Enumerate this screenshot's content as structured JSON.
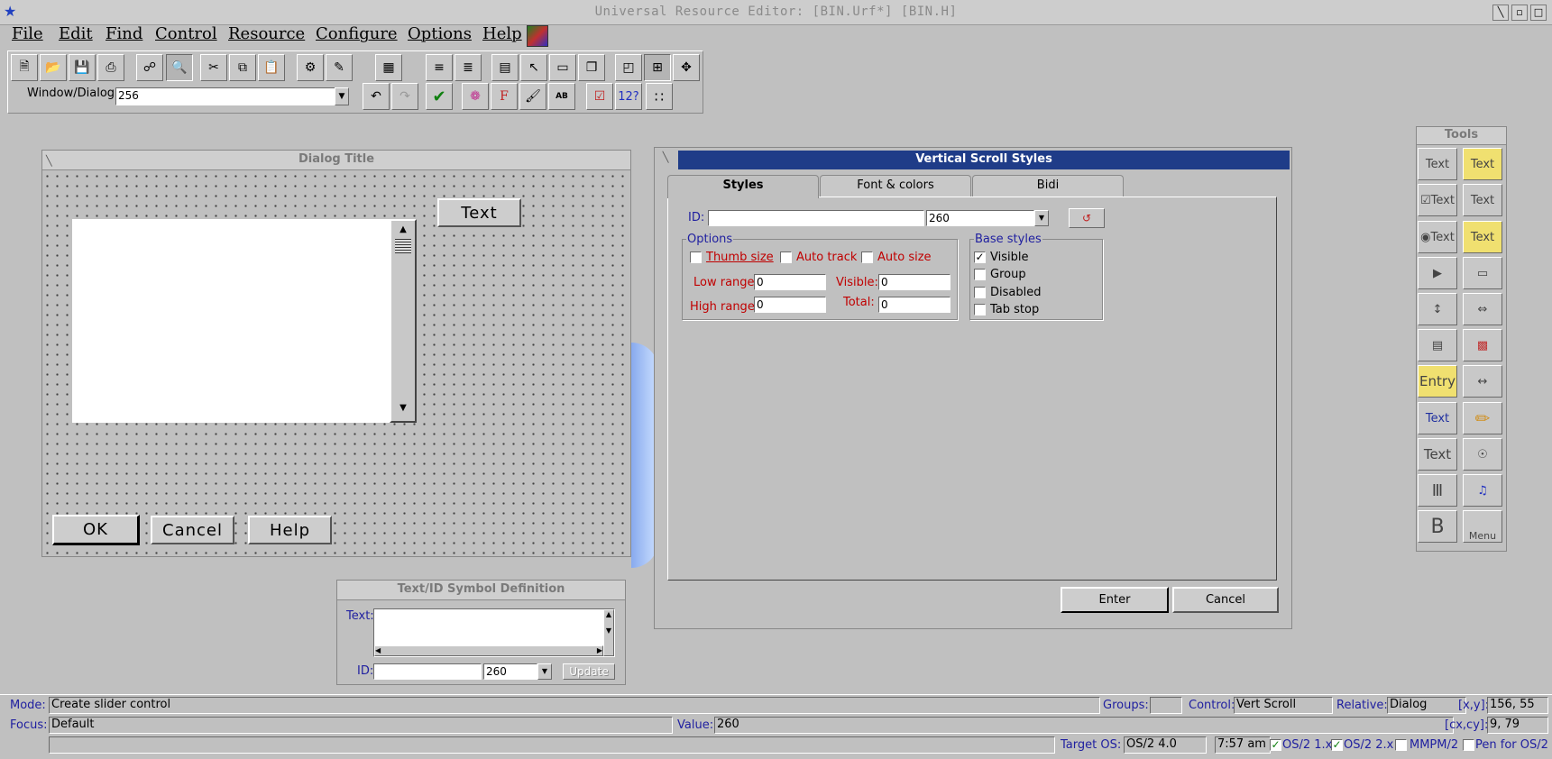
{
  "window": {
    "title": "Universal Resource Editor: [BIN.Urf*] [BIN.H]"
  },
  "menu": [
    "File",
    "Edit",
    "Find",
    "Control",
    "Resource",
    "Configure",
    "Options",
    "Help"
  ],
  "toolbar": {
    "window_dialog_label": "Window/Dialog:",
    "window_dialog_value": "256"
  },
  "dialog": {
    "title": "Dialog Title",
    "text_button": "Text",
    "ok": "OK",
    "cancel": "Cancel",
    "help": "Help"
  },
  "symbol_def": {
    "title": "Text/ID Symbol Definition",
    "text_label": "Text:",
    "id_label": "ID:",
    "id_value": "260",
    "update": "Update"
  },
  "styles_dialog": {
    "title": "Vertical Scroll Styles",
    "tabs": [
      "Styles",
      "Font & colors",
      "Bidi"
    ],
    "id_label": "ID:",
    "id_value": "260",
    "options_label": "Options",
    "thumb_size": "Thumb size",
    "auto_track": "Auto track",
    "auto_size": "Auto size",
    "low_range_label": "Low range:",
    "low_range": "0",
    "high_range_label": "High range:",
    "high_range": "0",
    "visible_label": "Visible:",
    "visible_value": "0",
    "total_label": "Total:",
    "total_value": "0",
    "base_styles_label": "Base styles",
    "base_visible": "Visible",
    "base_group": "Group",
    "base_disabled": "Disabled",
    "base_tabstop": "Tab stop",
    "enter": "Enter",
    "cancel": "Cancel"
  },
  "tools": {
    "title": "Tools",
    "items": [
      "Text",
      "Text",
      "Text",
      "Text",
      "Text",
      "Text",
      "Entry",
      "Text",
      "Text",
      "Menu"
    ]
  },
  "status": {
    "mode_label": "Mode:",
    "mode_value": "Create slider control",
    "groups_label": "Groups:",
    "control_label": "Control:",
    "control_value": "Vert Scroll",
    "relative_label": "Relative:",
    "relative_value": "Dialog",
    "xy_label": "[x,y]:",
    "xy_value": "156, 55",
    "focus_label": "Focus:",
    "focus_value": "Default",
    "value_label": "Value:",
    "value_value": "260",
    "cxcy_label": "[cx,cy]:",
    "cxcy_value": "9, 79",
    "target_label": "Target OS:",
    "target_value": "OS/2 4.0",
    "time": "7:57 am",
    "os21": "OS/2 1.x",
    "os22": "OS/2 2.x",
    "mmpm": "MMPM/2",
    "pen": "Pen for OS/2"
  }
}
